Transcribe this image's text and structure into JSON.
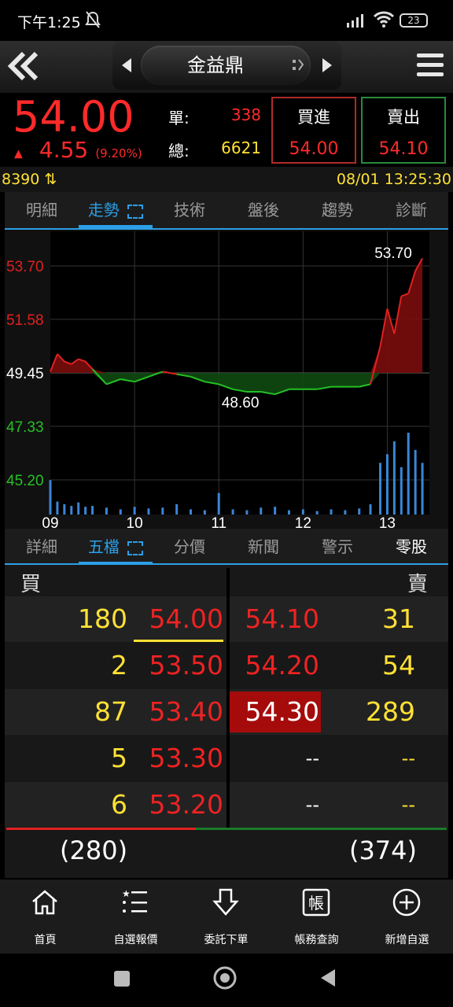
{
  "status": {
    "time": "下午1:25",
    "battery": "23"
  },
  "header": {
    "stock_name": "金益鼎"
  },
  "quote": {
    "price": "54.00",
    "change": "4.55",
    "change_pct": "(9.20%)",
    "single_label": "單:",
    "single_value": "338",
    "total_label": "總:",
    "total_value": "6621",
    "buy_label": "買進",
    "buy_price": "54.00",
    "sell_label": "賣出",
    "sell_price": "54.10"
  },
  "infobar": {
    "volume": "8390",
    "datetime": "08/01 13:25:30"
  },
  "tabs_top": [
    "明細",
    "走勢",
    "技術",
    "盤後",
    "趨勢",
    "診斷"
  ],
  "tabs_bottom": [
    "詳細",
    "五檔",
    "分價",
    "新聞",
    "警示",
    "零股"
  ],
  "chart_data": {
    "type": "line",
    "y_ticks": [
      "53.70",
      "51.58",
      "49.45",
      "47.33",
      "45.20"
    ],
    "x_ticks": [
      "09",
      "10",
      "11",
      "12",
      "13"
    ],
    "reference_price": 49.45,
    "ylim": [
      45.2,
      53.7
    ],
    "high_label": "53.70",
    "low_label": "48.60",
    "colors": {
      "up": "#e02020",
      "down": "#25c025",
      "volume": "#3a86d6"
    },
    "x": [
      "09:00",
      "09:05",
      "09:10",
      "09:15",
      "09:20",
      "09:25",
      "09:30",
      "09:40",
      "09:50",
      "10:00",
      "10:10",
      "10:20",
      "10:30",
      "10:40",
      "10:50",
      "11:00",
      "11:10",
      "11:20",
      "11:30",
      "11:40",
      "11:50",
      "12:00",
      "12:10",
      "12:20",
      "12:30",
      "12:40",
      "12:48",
      "12:55",
      "13:00",
      "13:05",
      "13:10",
      "13:15",
      "13:20",
      "13:25"
    ],
    "price": [
      49.5,
      50.2,
      49.9,
      49.8,
      50.0,
      49.9,
      49.6,
      49.0,
      49.2,
      49.1,
      49.3,
      49.5,
      49.4,
      49.3,
      49.1,
      49.0,
      48.8,
      48.7,
      48.7,
      48.6,
      48.8,
      48.8,
      48.8,
      48.9,
      48.9,
      48.9,
      49.0,
      50.5,
      52.0,
      51.0,
      52.5,
      52.6,
      53.5,
      54.0
    ],
    "volume": [
      40,
      15,
      12,
      10,
      14,
      9,
      10,
      8,
      6,
      9,
      7,
      8,
      12,
      6,
      5,
      25,
      6,
      5,
      8,
      9,
      5,
      6,
      4,
      6,
      5,
      7,
      12,
      60,
      70,
      85,
      55,
      95,
      75,
      60
    ]
  },
  "order_book": {
    "bid_label": "買",
    "ask_label": "賣",
    "bids": [
      {
        "vol": "180",
        "price": "54.00"
      },
      {
        "vol": "2",
        "price": "53.50"
      },
      {
        "vol": "87",
        "price": "53.40"
      },
      {
        "vol": "5",
        "price": "53.30"
      },
      {
        "vol": "6",
        "price": "53.20"
      }
    ],
    "asks": [
      {
        "price": "54.10",
        "vol": "31"
      },
      {
        "price": "54.20",
        "vol": "54"
      },
      {
        "price": "54.30",
        "vol": "289"
      },
      {
        "price": "--",
        "vol": "--"
      },
      {
        "price": "--",
        "vol": "--"
      }
    ],
    "total_bid": "(280)",
    "total_ask": "(374)",
    "bid_ratio": 0.43
  },
  "bottom_nav": [
    "首頁",
    "自選報價",
    "委託下單",
    "帳務查詢",
    "新增自選"
  ]
}
